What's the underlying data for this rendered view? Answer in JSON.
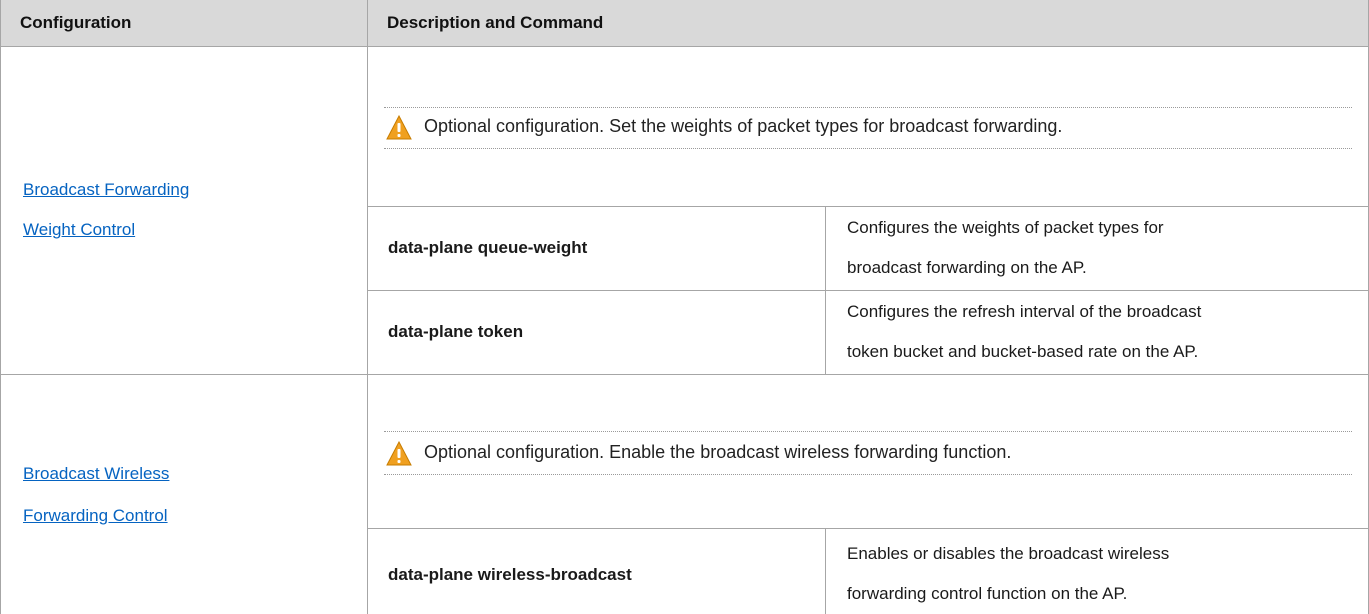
{
  "header": {
    "col1": "Configuration",
    "col2": "Description and Command"
  },
  "sections": [
    {
      "link_lines": [
        "Broadcast Forwarding ",
        "Weight Control"
      ],
      "note_icon": "warning-icon",
      "note": "Optional configuration. Set the weights of packet types for broadcast forwarding.",
      "commands": [
        {
          "command": "data-plane queue-weight",
          "desc_lines": [
            "Configures the weights of packet types for",
            "broadcast forwarding on the AP."
          ]
        },
        {
          "command": "data-plane token",
          "desc_lines": [
            "Configures the refresh interval of the broadcast",
            "token bucket and bucket-based rate on the AP."
          ]
        }
      ]
    },
    {
      "link_lines": [
        "Broadcast Wireless ",
        "Forwarding Control"
      ],
      "note_icon": "warning-icon",
      "note": "Optional configuration. Enable the broadcast wireless forwarding function.",
      "commands": [
        {
          "command": "data-plane wireless-broadcast",
          "desc_lines": [
            "Enables or disables the broadcast wireless",
            "forwarding control function on the AP."
          ]
        }
      ]
    }
  ],
  "colors": {
    "header_bg": "#d9d9d9",
    "link": "#0563c1",
    "warning": "#f0a020"
  }
}
